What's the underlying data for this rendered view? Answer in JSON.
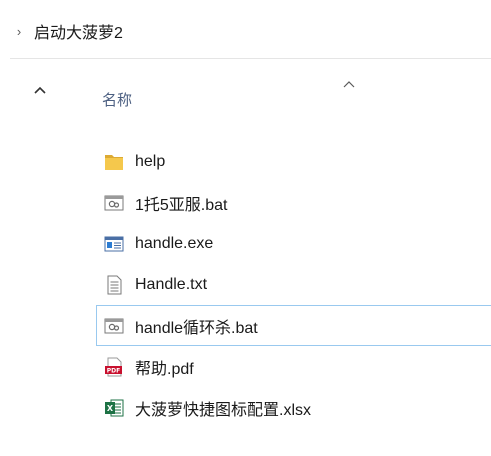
{
  "breadcrumb": {
    "separator": "›",
    "current": "启动大菠萝2"
  },
  "columns": {
    "name_header": "名称",
    "sort_direction": "ascending"
  },
  "files": [
    {
      "name": "help",
      "icon": "folder-icon"
    },
    {
      "name": "1托5亚服.bat",
      "icon": "batch-file-icon"
    },
    {
      "name": "handle.exe",
      "icon": "executable-icon"
    },
    {
      "name": "Handle.txt",
      "icon": "text-file-icon"
    },
    {
      "name": "handle循环杀.bat",
      "icon": "batch-file-icon",
      "focused": true
    },
    {
      "name": "帮助.pdf",
      "icon": "pdf-file-icon"
    },
    {
      "name": "大菠萝快捷图标配置.xlsx",
      "icon": "excel-file-icon"
    }
  ],
  "colors": {
    "folder": "#f5c84c",
    "pdf": "#c8102e",
    "excel": "#1d7245",
    "focus_border": "#99c9ef",
    "header_text": "#4d6082"
  }
}
